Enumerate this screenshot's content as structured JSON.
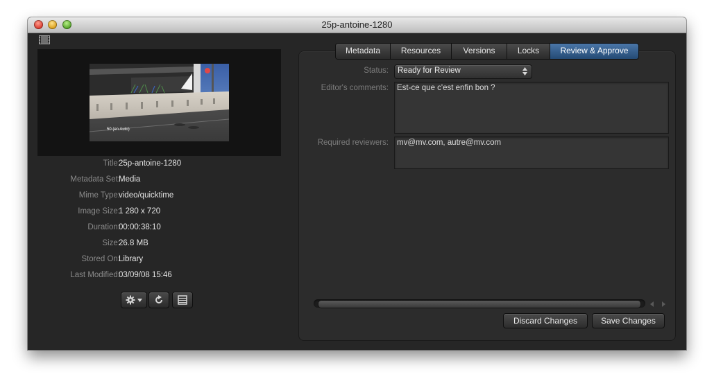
{
  "window": {
    "title": "25p-antoine-1280"
  },
  "preview": {
    "overlay_text": "50 (en Auto)"
  },
  "metadata": [
    {
      "label": "Title:",
      "value": "25p-antoine-1280"
    },
    {
      "label": "Metadata Set:",
      "value": "Media"
    },
    {
      "label": "Mime Type:",
      "value": "video/quicktime"
    },
    {
      "label": "Image Size:",
      "value": "1 280 x 720"
    },
    {
      "label": "Duration:",
      "value": "00:00:38:10"
    },
    {
      "label": "Size:",
      "value": "26.8 MB"
    },
    {
      "label": "Stored On:",
      "value": "Library"
    },
    {
      "label": "Last Modified:",
      "value": "03/09/08 15:46"
    }
  ],
  "toolbar": {
    "icons": [
      "gear-menu-icon",
      "refresh-icon",
      "grid-icon"
    ]
  },
  "tabs": [
    {
      "label": "Metadata",
      "active": false
    },
    {
      "label": "Resources",
      "active": false
    },
    {
      "label": "Versions",
      "active": false
    },
    {
      "label": "Locks",
      "active": false
    },
    {
      "label": "Review & Approve",
      "active": true
    }
  ],
  "form": {
    "status_label": "Status:",
    "status_value": "Ready for Review",
    "comments_label": "Editor's comments:",
    "comments_value": "Est-ce que c'est enfin bon ?",
    "reviewers_label": "Required reviewers:",
    "reviewers_value": "mv@mv.com, autre@mv.com"
  },
  "actions": {
    "discard_label": "Discard Changes",
    "save_label": "Save Changes"
  },
  "colors": {
    "window_bg": "#262626",
    "active_tab": "#3a6392",
    "text_light": "#e4e4e4",
    "label_gray": "#8a8a8a"
  }
}
